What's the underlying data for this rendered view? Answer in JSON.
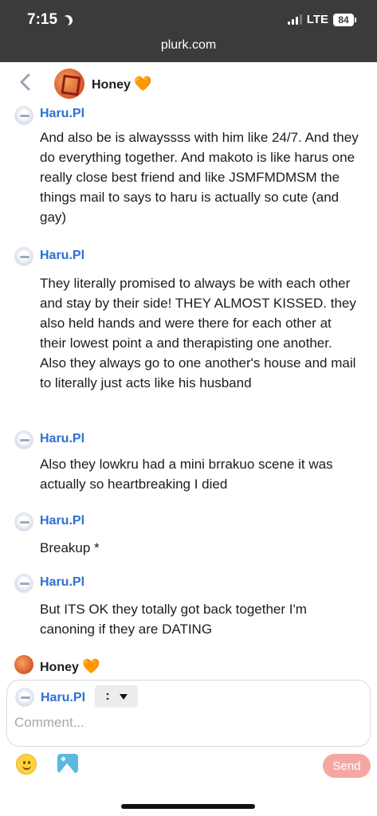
{
  "status_bar": {
    "time": "7:15",
    "network": "LTE",
    "battery": "84"
  },
  "browser": {
    "url": "plurk.com"
  },
  "header": {
    "user_name": "Honey",
    "heart": "🧡"
  },
  "responses": [
    {
      "author": "Haru.Pl",
      "text": "And also be is alwayssss with him like 24/7. And they do everything together. And makoto is like harus one really close best friend and like JSMFMDMSM the things mail to says to haru is actually so cute (and gay)"
    },
    {
      "author": "Haru.Pl",
      "text": "They literally promised to always be with each other and stay by their side! THEY ALMOST KISSED. they also held hands and were there for each other at their lowest point a and therapisting one another. Also they always go to one another's house and mail to literally just acts like his husband"
    },
    {
      "author": "Haru.Pl",
      "text": "Also they lowkru had a mini brrakuo scene it was actually so heartbreaking I died"
    },
    {
      "author": "Haru.Pl",
      "text": "Breakup *"
    },
    {
      "author": "Haru.Pl",
      "text": "But ITS OK they totally got back together I'm canoning if they are DATING"
    }
  ],
  "partial_response": {
    "author": "Honey",
    "heart": "🧡"
  },
  "composer": {
    "author": "Haru.Pl",
    "qualifier": ":",
    "placeholder": "Comment...",
    "send_label": "Send"
  },
  "icons": {
    "back": "chevron-left-icon",
    "emoji": "smiley-icon",
    "image": "image-icon",
    "moon": "moon-icon",
    "signal": "signal-icon",
    "battery": "battery-icon"
  },
  "colors": {
    "link_blue": "#2e6fd3",
    "send_pink": "#f5a8a3",
    "chrome_dark": "#3b3b3b"
  }
}
